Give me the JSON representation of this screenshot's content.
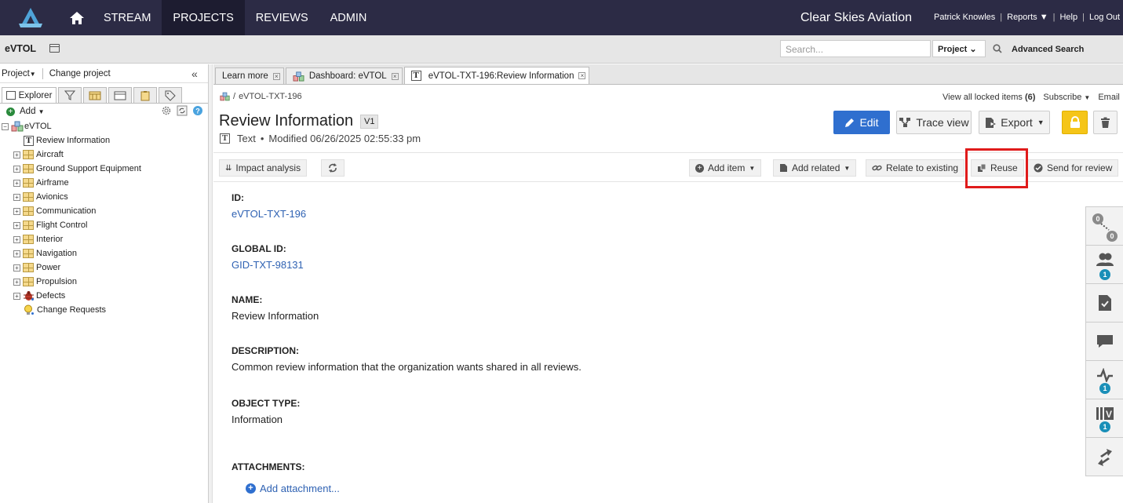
{
  "nav": {
    "items": [
      "STREAM",
      "PROJECTS",
      "REVIEWS",
      "ADMIN"
    ],
    "active": "PROJECTS",
    "org": "Clear Skies Aviation",
    "user": "Patrick Knowles",
    "reports": "Reports",
    "help": "Help",
    "logout": "Log Out"
  },
  "subbar": {
    "project": "eVTOL",
    "search_placeholder": "Search...",
    "scope": "Project",
    "advanced": "Advanced Search"
  },
  "left": {
    "project_menu": "Project",
    "change_project": "Change project",
    "explorer_tab": "Explorer",
    "add": "Add",
    "tree": {
      "root": "eVTOL",
      "items": [
        {
          "label": "Review Information",
          "kind": "text"
        },
        {
          "label": "Aircraft",
          "kind": "folder"
        },
        {
          "label": "Ground Support Equipment",
          "kind": "folder"
        },
        {
          "label": "Airframe",
          "kind": "folder"
        },
        {
          "label": "Avionics",
          "kind": "folder"
        },
        {
          "label": "Communication",
          "kind": "folder"
        },
        {
          "label": "Flight Control",
          "kind": "folder"
        },
        {
          "label": "Interior",
          "kind": "folder"
        },
        {
          "label": "Navigation",
          "kind": "folder"
        },
        {
          "label": "Power",
          "kind": "folder"
        },
        {
          "label": "Propulsion",
          "kind": "folder"
        },
        {
          "label": "Defects",
          "kind": "bug"
        },
        {
          "label": "Change Requests",
          "kind": "bulb"
        }
      ]
    }
  },
  "tabs": [
    {
      "label": "Learn more"
    },
    {
      "label": "Dashboard: eVTOL"
    },
    {
      "label": "eVTOL-TXT-196:Review Information"
    }
  ],
  "main": {
    "breadcrumb": "eVTOL-TXT-196",
    "locked_label": "View all locked items",
    "locked_count": "(6)",
    "subscribe": "Subscribe",
    "email": "Email",
    "title": "Review Information",
    "version": "V1",
    "type": "Text",
    "modified": "Modified 06/26/2025 02:55:33 pm",
    "buttons": {
      "edit": "Edit",
      "trace": "Trace view",
      "export": "Export"
    },
    "toolbar": {
      "impact": "Impact analysis",
      "add_item": "Add item",
      "add_related": "Add related",
      "relate": "Relate to existing",
      "reuse": "Reuse",
      "send_review": "Send for review"
    },
    "fields": {
      "id_label": "ID:",
      "id_value": "eVTOL-TXT-196",
      "gid_label": "GLOBAL ID:",
      "gid_value": "GID-TXT-98131",
      "name_label": "NAME:",
      "name_value": "Review Information",
      "desc_label": "DESCRIPTION:",
      "desc_value": "Common review information that the organization wants shared in all reviews.",
      "otype_label": "OBJECT TYPE:",
      "otype_value": "Information",
      "attach_label": "ATTACHMENTS:",
      "attach_link": "Add attachment..."
    }
  },
  "rail": {
    "trace_up": "0",
    "trace_down": "0",
    "reviewers": "1",
    "activity": "1",
    "versions": "1"
  }
}
